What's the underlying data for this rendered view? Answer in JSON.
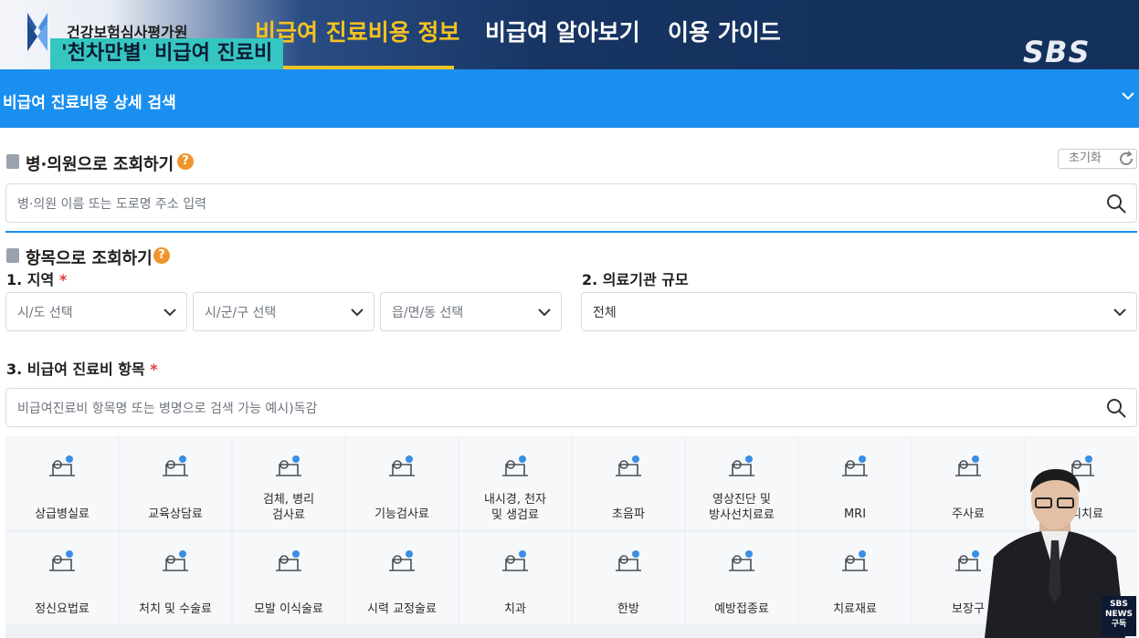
{
  "header": {
    "org_name": "건강보험심사평가원",
    "nav": [
      "비급여 진료비용 정보",
      "비급여 알아보기",
      "이용 가이드"
    ],
    "caption": "'천차만별' 비급여 진료비",
    "broadcaster": "SBS"
  },
  "search_header": {
    "title": "비급여 진료비용 상세 검색"
  },
  "hospital_search": {
    "title": "병·의원으로 조회하기",
    "reset_label": "초기화",
    "placeholder": "병·의원 이름 또는 도로명 주소 입력"
  },
  "item_search": {
    "title": "항목으로 조회하기",
    "region_label": "1. 지역",
    "region_selects": [
      "시/도 선택",
      "시/군/구 선택",
      "읍/면/동 선택"
    ],
    "scale_label": "2. 의료기관 규모",
    "scale_value": "전체",
    "category_label": "3. 비급여 진료비 항목",
    "category_placeholder": "비급여진료비 항목명 또는 병명으로 검색 가능 예시)독감",
    "required_mark": "*"
  },
  "categories": [
    [
      "상급병실료",
      "교육상담료",
      "검체, 병리\n검사료",
      "기능검사료",
      "내시경, 천자\n및 생검료",
      "초음파",
      "영상진단 및\n방사선치료료",
      "MRI",
      "주사료",
      "물리치료"
    ],
    [
      "정신요법료",
      "처치 및 수술료",
      "모발 이식술료",
      "시력 교정술료",
      "치과",
      "한방",
      "예방접종료",
      "치료재료",
      "보장구",
      ""
    ]
  ],
  "badge": {
    "line1": "SBS",
    "line2": "NEWS",
    "line3": "구독"
  },
  "colors": {
    "primary_blue": "#1a8ff0",
    "accent_yellow": "#f6c21f",
    "caption_teal": "#35c6c2",
    "help_orange": "#f0952d"
  }
}
